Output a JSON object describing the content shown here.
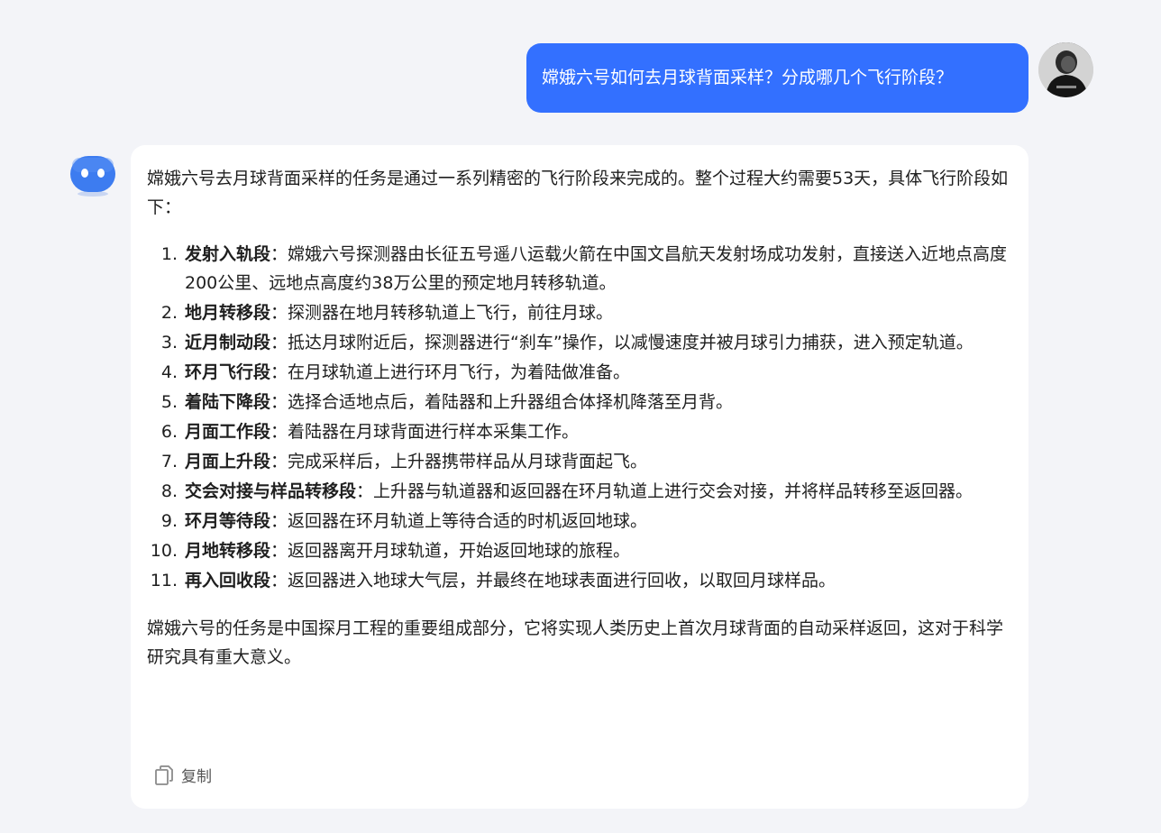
{
  "user_message": {
    "text": "嫦娥六号如何去月球背面采样？分成哪几个飞行阶段？"
  },
  "assistant_message": {
    "intro": "嫦娥六号去月球背面采样的任务是通过一系列精密的飞行阶段来完成的。整个过程大约需要53天，具体飞行阶段如下：",
    "steps": [
      {
        "num": "1.",
        "title": "发射入轨段",
        "sep": "：",
        "text": "嫦娥六号探测器由长征五号遥八运载火箭在中国文昌航天发射场成功发射，直接送入近地点高度200公里、远地点高度约38万公里的预定地月转移轨道。"
      },
      {
        "num": "2.",
        "title": "地月转移段",
        "sep": "：",
        "text": "探测器在地月转移轨道上飞行，前往月球。"
      },
      {
        "num": "3.",
        "title": "近月制动段",
        "sep": "：",
        "text": "抵达月球附近后，探测器进行“刹车”操作，以减慢速度并被月球引力捕获，进入预定轨道。"
      },
      {
        "num": "4.",
        "title": "环月飞行段",
        "sep": "：",
        "text": "在月球轨道上进行环月飞行，为着陆做准备。"
      },
      {
        "num": "5.",
        "title": "着陆下降段",
        "sep": "：",
        "text": "选择合适地点后，着陆器和上升器组合体择机降落至月背。"
      },
      {
        "num": "6.",
        "title": "月面工作段",
        "sep": "：",
        "text": "着陆器在月球背面进行样本采集工作。"
      },
      {
        "num": "7.",
        "title": "月面上升段",
        "sep": "：",
        "text": "完成采样后，上升器携带样品从月球背面起飞。"
      },
      {
        "num": "8.",
        "title": "交会对接与样品转移段",
        "sep": "：",
        "text": "上升器与轨道器和返回器在环月轨道上进行交会对接，并将样品转移至返回器。"
      },
      {
        "num": "9.",
        "title": "环月等待段",
        "sep": "：",
        "text": "返回器在环月轨道上等待合适的时机返回地球。"
      },
      {
        "num": "10.",
        "title": "月地转移段",
        "sep": "：",
        "text": "返回器离开月球轨道，开始返回地球的旅程。"
      },
      {
        "num": "11.",
        "title": "再入回收段",
        "sep": "：",
        "text": "返回器进入地球大气层，并最终在地球表面进行回收，以取回月球样品。"
      }
    ],
    "conclusion": "嫦娥六号的任务是中国探月工程的重要组成部分，它将实现人类历史上首次月球背面的自动采样返回，这对于科学研究具有重大意义。",
    "copy_label": "复制"
  },
  "colors": {
    "background": "#f3f4f8",
    "user_bubble": "#3370ff",
    "card": "#ffffff",
    "bot_avatar": "#3d7cf0"
  },
  "icons": {
    "bot_avatar": "robot-face-icon",
    "copy": "copy-icon"
  }
}
